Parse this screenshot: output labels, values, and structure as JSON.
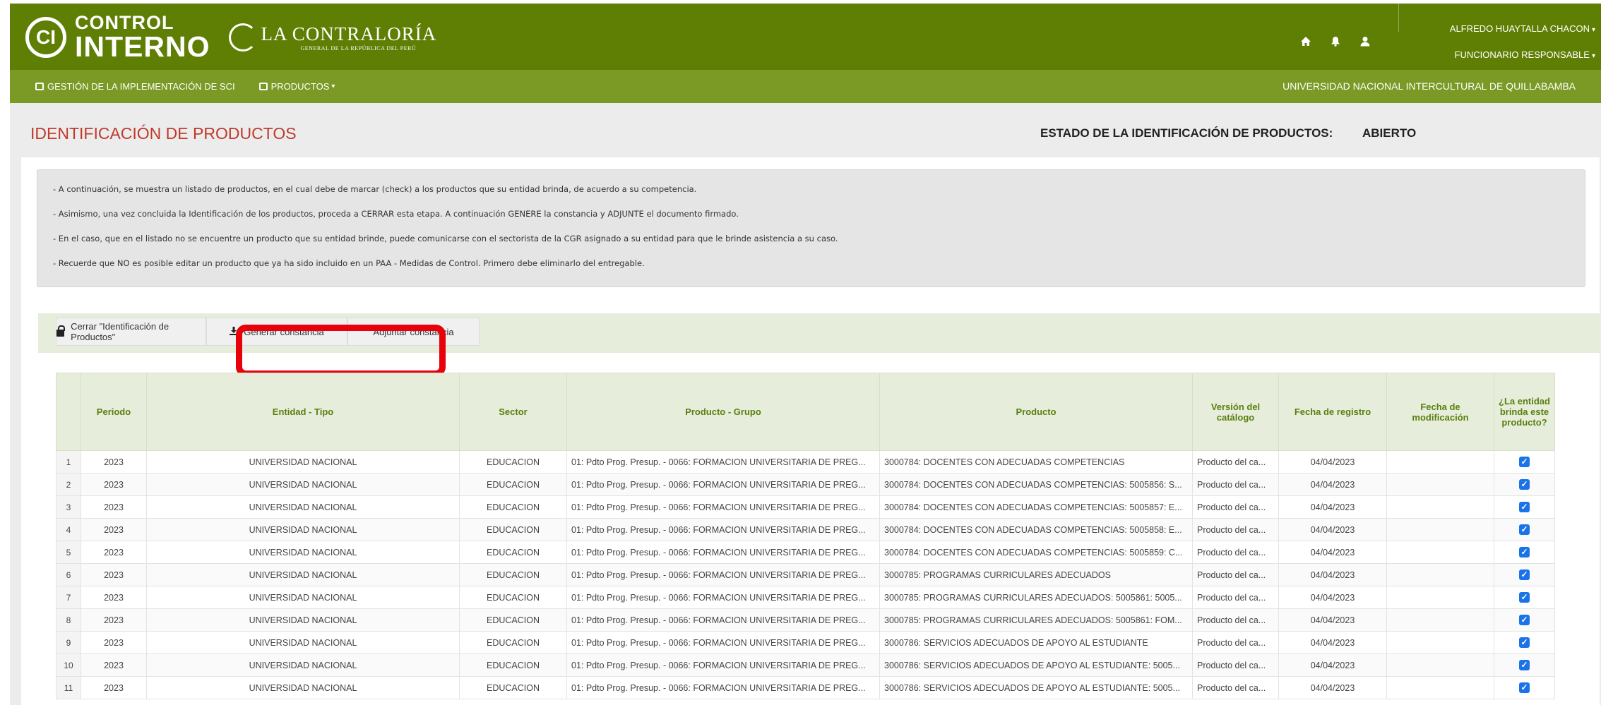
{
  "header": {
    "logo_mark": "CI",
    "logo_line1": "CONTROL",
    "logo_line2": "INTERNO",
    "contraloria_title": "LA CONTRALORÍA",
    "contraloria_subtitle": "GENERAL DE LA REPÚBLICA DEL PERÚ",
    "user_name": "ALFREDO HUAYTALLA CHACON",
    "user_role": "FUNCIONARIO RESPONSABLE",
    "icons": [
      "home-icon",
      "bell-icon",
      "user-icon"
    ]
  },
  "navbar": {
    "items": [
      {
        "label": "GESTIÓN DE LA IMPLEMENTACIÓN DE SCI",
        "has_caret": false
      },
      {
        "label": "PRODUCTOS",
        "has_caret": true
      }
    ],
    "entity": "UNIVERSIDAD NACIONAL INTERCULTURAL DE QUILLABAMBA"
  },
  "page": {
    "title": "IDENTIFICACIÓN DE PRODUCTOS",
    "estado_label": "ESTADO DE LA IDENTIFICACIÓN DE PRODUCTOS:",
    "estado_value": "ABIERTO"
  },
  "info": [
    "- A continuación, se muestra un listado de productos, en el cual debe de marcar (check) a los productos que su entidad brinda, de acuerdo a su competencia.",
    "- Asimismo, una vez concluida la Identificación de los productos, proceda a CERRAR esta etapa. A continuación GENERE la constancia y ADJUNTE el documento firmado.",
    "- En el caso, que en el listado no se encuentre un producto que su entidad brinde, puede comunicarse con el sectorista de la CGR asignado a su entidad para que le brinde asistencia a su caso.",
    "- Recuerde que NO es posible editar un producto que ya ha sido incluido en un PAA - Medidas de Control. Primero debe eliminarlo del entregable."
  ],
  "actions": {
    "close_label": "Cerrar \"Identificación de Productos\"",
    "generate_label": "Generar constancia",
    "attach_label": "Adjuntar constancia"
  },
  "table": {
    "headers": [
      "",
      "Periodo",
      "Entidad - Tipo",
      "Sector",
      "Producto - Grupo",
      "Producto",
      "Versión del catálogo",
      "Fecha de registro",
      "Fecha de modificación",
      "¿La entidad brinda este producto?"
    ],
    "rows": [
      {
        "n": "1",
        "periodo": "2023",
        "entidad": "UNIVERSIDAD NACIONAL",
        "sector": "EDUCACION",
        "grupo": "01: Pdto Prog. Presup. - 0066: FORMACION UNIVERSITARIA DE PREG...",
        "producto": "3000784: DOCENTES CON ADECUADAS COMPETENCIAS",
        "version": "Producto del ca...",
        "fecha_reg": "04/04/2023",
        "fecha_mod": "",
        "checked": true
      },
      {
        "n": "2",
        "periodo": "2023",
        "entidad": "UNIVERSIDAD NACIONAL",
        "sector": "EDUCACION",
        "grupo": "01: Pdto Prog. Presup. - 0066: FORMACION UNIVERSITARIA DE PREG...",
        "producto": "3000784: DOCENTES CON ADECUADAS COMPETENCIAS: 5005856: S...",
        "version": "Producto del ca...",
        "fecha_reg": "04/04/2023",
        "fecha_mod": "",
        "checked": true
      },
      {
        "n": "3",
        "periodo": "2023",
        "entidad": "UNIVERSIDAD NACIONAL",
        "sector": "EDUCACION",
        "grupo": "01: Pdto Prog. Presup. - 0066: FORMACION UNIVERSITARIA DE PREG...",
        "producto": "3000784: DOCENTES CON ADECUADAS COMPETENCIAS: 5005857: E...",
        "version": "Producto del ca...",
        "fecha_reg": "04/04/2023",
        "fecha_mod": "",
        "checked": true
      },
      {
        "n": "4",
        "periodo": "2023",
        "entidad": "UNIVERSIDAD NACIONAL",
        "sector": "EDUCACION",
        "grupo": "01: Pdto Prog. Presup. - 0066: FORMACION UNIVERSITARIA DE PREG...",
        "producto": "3000784: DOCENTES CON ADECUADAS COMPETENCIAS: 5005858: E...",
        "version": "Producto del ca...",
        "fecha_reg": "04/04/2023",
        "fecha_mod": "",
        "checked": true
      },
      {
        "n": "5",
        "periodo": "2023",
        "entidad": "UNIVERSIDAD NACIONAL",
        "sector": "EDUCACION",
        "grupo": "01: Pdto Prog. Presup. - 0066: FORMACION UNIVERSITARIA DE PREG...",
        "producto": "3000784: DOCENTES CON ADECUADAS COMPETENCIAS: 5005859: C...",
        "version": "Producto del ca...",
        "fecha_reg": "04/04/2023",
        "fecha_mod": "",
        "checked": true
      },
      {
        "n": "6",
        "periodo": "2023",
        "entidad": "UNIVERSIDAD NACIONAL",
        "sector": "EDUCACION",
        "grupo": "01: Pdto Prog. Presup. - 0066: FORMACION UNIVERSITARIA DE PREG...",
        "producto": "3000785: PROGRAMAS CURRICULARES ADECUADOS",
        "version": "Producto del ca...",
        "fecha_reg": "04/04/2023",
        "fecha_mod": "",
        "checked": true
      },
      {
        "n": "7",
        "periodo": "2023",
        "entidad": "UNIVERSIDAD NACIONAL",
        "sector": "EDUCACION",
        "grupo": "01: Pdto Prog. Presup. - 0066: FORMACION UNIVERSITARIA DE PREG...",
        "producto": "3000785: PROGRAMAS CURRICULARES ADECUADOS: 5005861: 5005...",
        "version": "Producto del ca...",
        "fecha_reg": "04/04/2023",
        "fecha_mod": "",
        "checked": true
      },
      {
        "n": "8",
        "periodo": "2023",
        "entidad": "UNIVERSIDAD NACIONAL",
        "sector": "EDUCACION",
        "grupo": "01: Pdto Prog. Presup. - 0066: FORMACION UNIVERSITARIA DE PREG...",
        "producto": "3000785: PROGRAMAS CURRICULARES ADECUADOS: 5005861: FOM...",
        "version": "Producto del ca...",
        "fecha_reg": "04/04/2023",
        "fecha_mod": "",
        "checked": true
      },
      {
        "n": "9",
        "periodo": "2023",
        "entidad": "UNIVERSIDAD NACIONAL",
        "sector": "EDUCACION",
        "grupo": "01: Pdto Prog. Presup. - 0066: FORMACION UNIVERSITARIA DE PREG...",
        "producto": "3000786: SERVICIOS ADECUADOS DE APOYO AL ESTUDIANTE",
        "version": "Producto del ca...",
        "fecha_reg": "04/04/2023",
        "fecha_mod": "",
        "checked": true
      },
      {
        "n": "10",
        "periodo": "2023",
        "entidad": "UNIVERSIDAD NACIONAL",
        "sector": "EDUCACION",
        "grupo": "01: Pdto Prog. Presup. - 0066: FORMACION UNIVERSITARIA DE PREG...",
        "producto": "3000786: SERVICIOS ADECUADOS DE APOYO AL ESTUDIANTE: 5005...",
        "version": "Producto del ca...",
        "fecha_reg": "04/04/2023",
        "fecha_mod": "",
        "checked": true
      },
      {
        "n": "11",
        "periodo": "2023",
        "entidad": "UNIVERSIDAD NACIONAL",
        "sector": "EDUCACION",
        "grupo": "01: Pdto Prog. Presup. - 0066: FORMACION UNIVERSITARIA DE PREG...",
        "producto": "3000786: SERVICIOS ADECUADOS DE APOYO AL ESTUDIANTE: 5005...",
        "version": "Producto del ca...",
        "fecha_reg": "04/04/2023",
        "fecha_mod": "",
        "checked": true
      }
    ]
  },
  "colors": {
    "header_green": "#5f7f04",
    "nav_green": "#7a9a25",
    "title_red": "#c0392b",
    "highlight_red": "#e8000b",
    "checkbox_blue": "#1a73e8"
  }
}
